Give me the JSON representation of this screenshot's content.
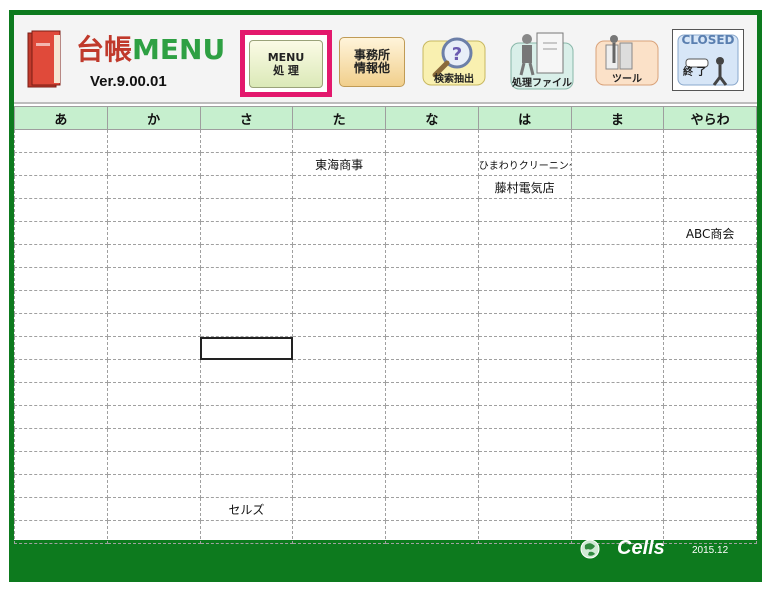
{
  "app": {
    "title_mark": "台帳",
    "title_text": "MENU",
    "version": "Ver.9.00.01"
  },
  "toolbar": {
    "menu_line1": "MENU",
    "menu_line2": "処 理",
    "office_line1": "事務所",
    "office_line2": "情報他",
    "search_label": "検索抽出",
    "file_label": "処理ファイル",
    "tools_label": "ツール",
    "closed_label": "CLOSED",
    "exit_label": "終 了"
  },
  "grid": {
    "headers": [
      "あ",
      "か",
      "さ",
      "た",
      "な",
      "は",
      "ま",
      "やらわ"
    ],
    "rows": [
      [
        "",
        "",
        "",
        "",
        "",
        "",
        "",
        ""
      ],
      [
        "",
        "",
        "",
        "東海商事",
        "",
        "ひまわりクリーニング",
        "",
        ""
      ],
      [
        "",
        "",
        "",
        "",
        "",
        "藤村電気店",
        "",
        ""
      ],
      [
        "",
        "",
        "",
        "",
        "",
        "",
        "",
        ""
      ],
      [
        "",
        "",
        "",
        "",
        "",
        "",
        "",
        "ABC商会"
      ],
      [
        "",
        "",
        "",
        "",
        "",
        "",
        "",
        ""
      ],
      [
        "",
        "",
        "",
        "",
        "",
        "",
        "",
        ""
      ],
      [
        "",
        "",
        "",
        "",
        "",
        "",
        "",
        ""
      ],
      [
        "",
        "",
        "",
        "",
        "",
        "",
        "",
        ""
      ],
      [
        "",
        "",
        "",
        "",
        "",
        "",
        "",
        ""
      ],
      [
        "",
        "",
        "",
        "",
        "",
        "",
        "",
        ""
      ],
      [
        "",
        "",
        "",
        "",
        "",
        "",
        "",
        ""
      ],
      [
        "",
        "",
        "",
        "",
        "",
        "",
        "",
        ""
      ],
      [
        "",
        "",
        "",
        "",
        "",
        "",
        "",
        ""
      ],
      [
        "",
        "",
        "",
        "",
        "",
        "",
        "",
        ""
      ],
      [
        "",
        "",
        "",
        "",
        "",
        "",
        "",
        ""
      ],
      [
        "",
        "",
        "セルズ",
        "",
        "",
        "",
        "",
        ""
      ],
      [
        "",
        "",
        "",
        "",
        "",
        "",
        "",
        ""
      ]
    ],
    "selected_cell": [
      9,
      2
    ]
  },
  "footer": {
    "brand": "Cells",
    "date": "2015.12"
  },
  "colors": {
    "frame": "#0d7a1e",
    "header_row": "#c6efce",
    "menu_highlight": "#e3186d",
    "title_green": "#2ea043",
    "title_red": "#c0392b"
  }
}
